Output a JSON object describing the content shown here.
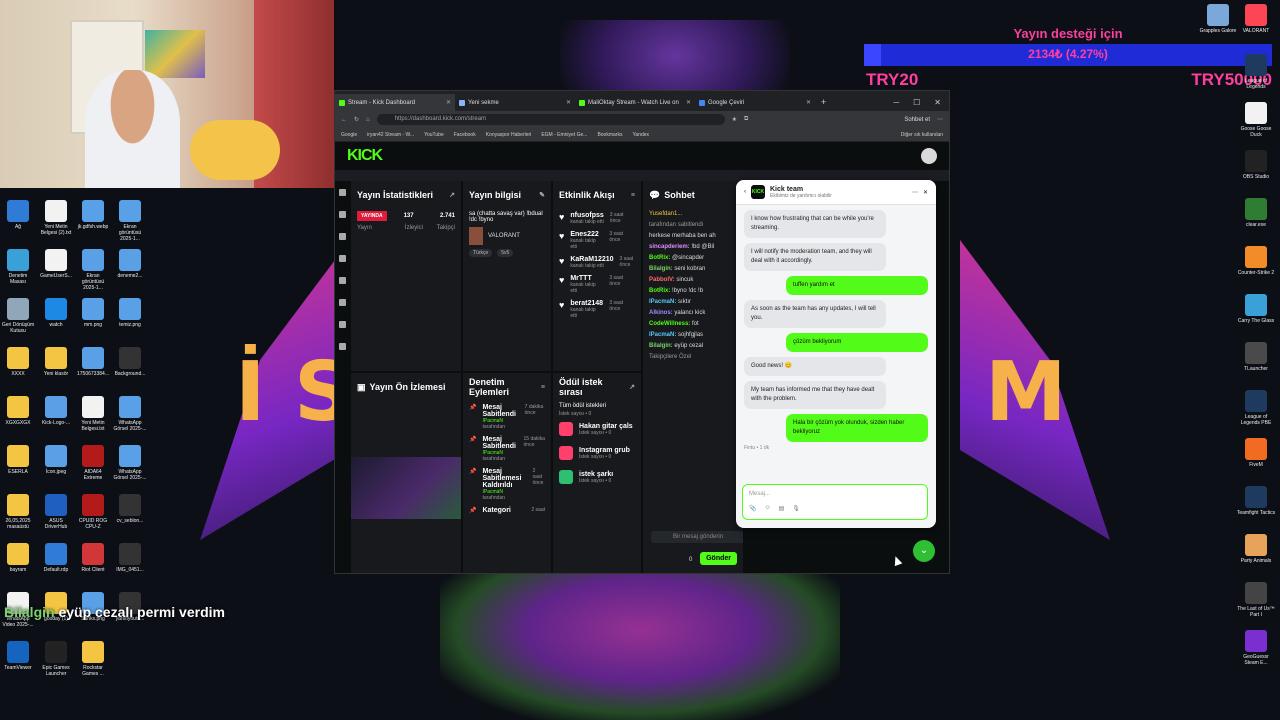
{
  "webcam": {
    "label": "streamer webcam"
  },
  "donation": {
    "title": "Yayın desteği için",
    "progress_text": "2134₺ (4.27%)",
    "progress_fraction": 0.0427,
    "min": "TRY20",
    "max": "TRY50000"
  },
  "desktop_left": [
    {
      "label": "Ağ",
      "color": "#2f7bd6"
    },
    {
      "label": "Yeni Metin Belgesi (2).txt",
      "color": "#f2f2f2"
    },
    {
      "label": "jk.gdfsh.webp",
      "color": "#5aa0e6"
    },
    {
      "label": "Ekran görüntüsü 2025-1...",
      "color": "#5aa0e6"
    },
    {
      "label": "Denetim Masası",
      "color": "#3aa0d8"
    },
    {
      "label": "GameUserS...",
      "color": "#f2f2f2"
    },
    {
      "label": "Ekran görüntüsü 2025-1...",
      "color": "#5aa0e6"
    },
    {
      "label": "deneme2...",
      "color": "#5aa0e6"
    },
    {
      "label": "Geri Dönüşüm Kutusu",
      "color": "#8fa7b8"
    },
    {
      "label": "watch",
      "color": "#1e88e5"
    },
    {
      "label": "mm.png",
      "color": "#5aa0e6"
    },
    {
      "label": "temiz.png",
      "color": "#5aa0e6"
    },
    {
      "label": "XXXX",
      "color": "#f4c542"
    },
    {
      "label": "Yeni klasör",
      "color": "#f4c542"
    },
    {
      "label": "1750673384...",
      "color": "#5aa0e6"
    },
    {
      "label": "Background...",
      "color": "#333333"
    },
    {
      "label": "XGXGXGX",
      "color": "#f4c542"
    },
    {
      "label": "Kick-Logo-...",
      "color": "#5aa0e6"
    },
    {
      "label": "Yeni Metin Belgesi.txt",
      "color": "#f2f2f2"
    },
    {
      "label": "WhatsApp Görsel 2025-...",
      "color": "#5aa0e6"
    },
    {
      "label": "ESERLA",
      "color": "#f4c542"
    },
    {
      "label": "İcon.jpeg",
      "color": "#5aa0e6"
    },
    {
      "label": "AIDA64 Extreme",
      "color": "#b31b1b"
    },
    {
      "label": "WhatsApp Görsel 2025-...",
      "color": "#5aa0e6"
    },
    {
      "label": "26,05,2025 masaüstü",
      "color": "#f4c542"
    },
    {
      "label": "ASUS DriverHub",
      "color": "#1f5fbf"
    },
    {
      "label": "CPUID ROG CPU-Z",
      "color": "#b31b1b"
    },
    {
      "label": "cv_seblon...",
      "color": "#333333"
    },
    {
      "label": "bayram",
      "color": "#f4c542"
    },
    {
      "label": "Default.rdp",
      "color": "#2f7bd6"
    },
    {
      "label": "Riot Client",
      "color": "#d13639"
    },
    {
      "label": "IMG_0451...",
      "color": "#333333"
    },
    {
      "label": "WhatsApp Video 2025-...",
      "color": "#f2f2f2"
    },
    {
      "label": "gooday (1)",
      "color": "#f4c542"
    },
    {
      "label": "Sanks.png",
      "color": "#5aa0e6"
    },
    {
      "label": "yarsoyoutu...",
      "color": "#333333"
    },
    {
      "label": "TeamViewer",
      "color": "#1565c0"
    },
    {
      "label": "Epic Games Launcher",
      "color": "#222222"
    },
    {
      "label": "Rockstar Games ...",
      "color": "#f4c542"
    }
  ],
  "desktop_right": [
    {
      "label": "Grapples Galore",
      "color": "#7aa8d8"
    },
    {
      "label": "VALORANT",
      "color": "#fd4556"
    },
    {
      "label": "League of Legends",
      "color": "#1e3a5f"
    },
    {
      "label": "Goose Goose Duck",
      "color": "#f2f2f2"
    },
    {
      "label": "OBS Studio",
      "color": "#222222"
    },
    {
      "label": "clear.exe",
      "color": "#2e7d32"
    },
    {
      "label": "Counter-Strike 2",
      "color": "#f28c28"
    },
    {
      "label": "Carry The Glass",
      "color": "#3aa0d8"
    },
    {
      "label": "TLauncher",
      "color": "#4a4a4a"
    },
    {
      "label": "League of Legends PBE",
      "color": "#1e3a5f"
    },
    {
      "label": "FiveM",
      "color": "#f26b22"
    },
    {
      "label": "Teamfight Tactics",
      "color": "#1e3a5f"
    },
    {
      "label": "Party Animals",
      "color": "#e8a35a"
    },
    {
      "label": "The Last of Us™ Part I",
      "color": "#444444"
    },
    {
      "label": "GeoGuessr Steam E...",
      "color": "#7b2fd1"
    }
  ],
  "overlay_chat": {
    "user": "Bilalgin",
    "text": " eyüp cezalı permi verdim"
  },
  "browser": {
    "tabs": [
      {
        "title": "Stream - Kick Dashboard"
      },
      {
        "title": "Yeni sekme"
      },
      {
        "title": "MaliOktay Stream - Watch Live on"
      },
      {
        "title": "Google Çeviri"
      }
    ],
    "new_tab": "+",
    "url": "https://dashboard.kick.com/stream",
    "sohbet": "Sohbet et",
    "bookmarks": [
      "Google",
      "iryan42 Stream - W...",
      "YouTube",
      "Facebook",
      "Konyaspor Haberleri",
      "EGM - Emniyet Ge...",
      "Bookmarks",
      "Yandex"
    ],
    "other_bookmarks": "Diğer sık kullanılan"
  },
  "kick": {
    "logo": "KICK",
    "stats": {
      "title": "Yayın İstatistikleri",
      "live": "YAYINDA",
      "live_sub": "Yayın",
      "viewers": "137",
      "viewers_label": "İzleyici",
      "follows": "2.741",
      "follows_label": "Takipçi"
    },
    "info": {
      "title": "Yayın bilgisi",
      "stream_title": "sa (chatta savaş var) !bdual !dc !byno",
      "category": "VALORANT",
      "tag1": "Türkçe",
      "tag2": "5v5"
    },
    "activity": {
      "title": "Etkinlik Akışı",
      "items": [
        {
          "name": "nfusofpss",
          "sub": "kanalı takip etti",
          "ago": "3 saat önce"
        },
        {
          "name": "Enes222",
          "sub": "kanalı takip etti",
          "ago": "3 saat önce"
        },
        {
          "name": "KaRaM12210",
          "sub": "kanalı takip etti",
          "ago": "3 saat önce"
        },
        {
          "name": "MrTTT",
          "sub": "kanalı takip etti",
          "ago": "3 saat önce"
        },
        {
          "name": "berat2148",
          "sub": "kanalı takip etti",
          "ago": "3 saat önce"
        }
      ]
    },
    "chat": {
      "title": "Sohbet",
      "pinned_user": "Yusefdan1...",
      "pinned_text": "herkese merhaba ben ah",
      "pinned_by": "tarafından sabitlendi",
      "lines": [
        {
          "user": "sincapderiem:",
          "text": " !bd @Bil",
          "color": "#e08bff"
        },
        {
          "user": "BotRix:",
          "text": " @sincapder",
          "color": "#53fc18"
        },
        {
          "user": "Bilalgin:",
          "text": " seni kobran",
          "color": "#7cd36c"
        },
        {
          "user": "PabboIV:",
          "text": " sincuk",
          "color": "#ff6b6b"
        },
        {
          "user": "BotRix:",
          "text": " !byno !dc !b",
          "color": "#53fc18"
        },
        {
          "user": "IPacmaN:",
          "text": " sıktır",
          "color": "#5ac8fa"
        },
        {
          "user": "Alkinos:",
          "text": " yalancı kick",
          "color": "#9b8cff"
        },
        {
          "user": "CodeWillness:",
          "text": " fot",
          "color": "#53fc18"
        },
        {
          "user": "IPacmaN:",
          "text": " sojhfgjlas",
          "color": "#5ac8fa"
        },
        {
          "user": "Bilalgin:",
          "text": " eyüp cezal",
          "color": "#7cd36c"
        }
      ],
      "followers_only": "Takipçilere Özel",
      "input_placeholder": "Bir mesaj gönderin",
      "send": "Gönder",
      "counter": "0"
    },
    "preview": {
      "title": "Yayın Ön İzlemesi"
    },
    "moderation": {
      "title": "Denetim Eylemleri",
      "items": [
        {
          "name": "Mesaj Sabitlendi",
          "by": "IPacmaN",
          "by_label": "tarafından",
          "ago": "7 dakika önce"
        },
        {
          "name": "Mesaj Sabitlendi",
          "by": "IPacmaN",
          "by_label": "tarafından",
          "ago": "15 dakika önce"
        },
        {
          "name": "Mesaj Sabitlemesi Kaldırıldı",
          "by": "IPacmaN",
          "by_label": "tarafından",
          "ago": "2 saat önce"
        },
        {
          "name": "Kategori",
          "by": "",
          "by_label": "",
          "ago": "2 saat"
        }
      ]
    },
    "rewards": {
      "title": "Ödül istek sırası",
      "all": "Tüm ödül istekleri",
      "all_sub": "İstek sayısı • 0",
      "items": [
        {
          "name": "Hakan gitar çals",
          "sub": "İstek sayısı • 0"
        },
        {
          "name": "Instagram grub",
          "sub": "İstek sayısı • 0"
        },
        {
          "name": "istek şarkı",
          "sub": "İstek sayısı • 0"
        }
      ]
    }
  },
  "support": {
    "title": "Kick team",
    "status": "Ekibimiz de yardımcı olabilir",
    "messages": [
      {
        "from": "them",
        "text": "I know how frustrating that can be while you're streaming."
      },
      {
        "from": "them",
        "text": "I will notify the moderation team, and they will deal with it accordingly."
      },
      {
        "from": "me",
        "text": "tuffen yardım et"
      },
      {
        "from": "them",
        "text": "As soon as the team has any updates, I will tell you."
      },
      {
        "from": "me",
        "text": "çözüm bekliyorum"
      },
      {
        "from": "them",
        "text": "Good news! 😊"
      },
      {
        "from": "them",
        "text": "My team has informed me that they have dealt with the problem."
      },
      {
        "from": "me",
        "text": "Hala bir çözüm yok olunduk, sizden haber bekliyoruz"
      }
    ],
    "meta": "Fintu • 1 dk",
    "input_placeholder": "Mesaj..."
  }
}
